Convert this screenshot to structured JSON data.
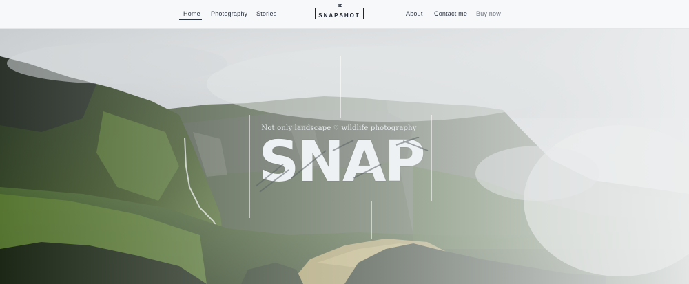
{
  "nav": {
    "left_items": [
      {
        "label": "Home"
      },
      {
        "label": "Photography"
      },
      {
        "label": "Stories"
      }
    ],
    "logo": {
      "main": "SNAPSHOT",
      "prefix": "BE"
    },
    "right_items": [
      {
        "label": "About"
      },
      {
        "label": "Contact me"
      },
      {
        "label": "Buy now"
      }
    ]
  },
  "hero": {
    "tagline_before": "Not only landscape",
    "tagline_heart": "♡",
    "tagline_after": "wildlife photography",
    "headline": "SNAP"
  },
  "colors": {
    "nav_bg": "#f7f8fa",
    "text_dark": "#2c3440",
    "text_muted": "#6f7680",
    "mountain_green": "#3f5a2a",
    "fog": "#e4e7e9"
  }
}
